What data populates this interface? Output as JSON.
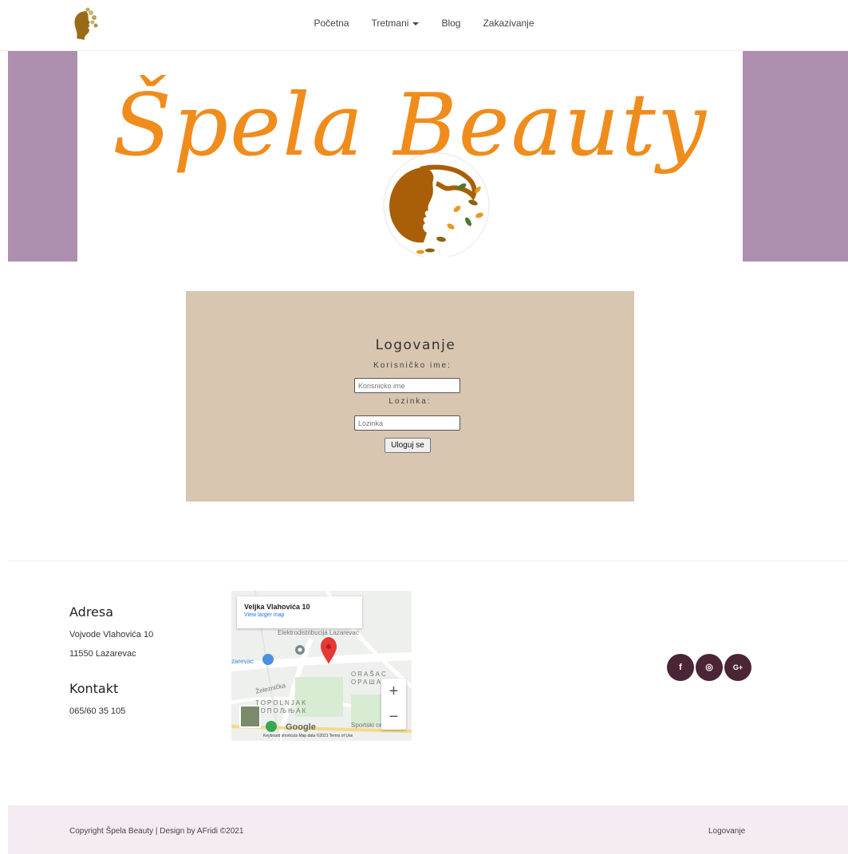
{
  "nav": {
    "items": [
      {
        "label": "Početna"
      },
      {
        "label": "Tretmani",
        "has_dropdown": true
      },
      {
        "label": "Blog"
      },
      {
        "label": "Zakazivanje"
      }
    ]
  },
  "hero": {
    "title": "Špela Beauty",
    "colors": {
      "side": "#af8fb0",
      "title": "#f08c1c",
      "medallion": "#a95f07"
    }
  },
  "login": {
    "heading": "Logovanje",
    "username_label": "Korisničko ime:",
    "username_placeholder": "Korisnicko ime",
    "password_label": "Lozinka:",
    "password_placeholder": "Lozinka",
    "submit_label": "Uloguj se",
    "background": "#d8c6b0"
  },
  "footer": {
    "address_heading": "Adresa",
    "address_line1": "Vojvode Vlahovića 10",
    "address_line2": "11550 Lazarevac",
    "contact_heading": "Kontakt",
    "phone": "065/60 35 105",
    "map": {
      "place_title": "Veljka Vlahovića 10",
      "view_larger": "View larger map",
      "labels": [
        "Elektrodistribucija Lazarevac",
        "zarevac",
        "ORAŠAC",
        "ОРАШАЦ",
        "Železnička",
        "TOPOLNJAK",
        "ТОПОЉЊАК",
        "Sportski centar"
      ],
      "google": "Google",
      "footer": "Keyboard shortcuts   Map data ©2021   Terms of Use"
    },
    "social": [
      {
        "icon": "facebook-icon",
        "glyph": "f"
      },
      {
        "icon": "instagram-icon",
        "glyph": "◎"
      },
      {
        "icon": "google-plus-icon",
        "glyph": "G+"
      }
    ],
    "social_color": "#4b2436"
  },
  "bottom_bar": {
    "copyright": "Copyright Špela Beauty | Design by AFridi ©2021",
    "login_link": "Logovanje"
  }
}
